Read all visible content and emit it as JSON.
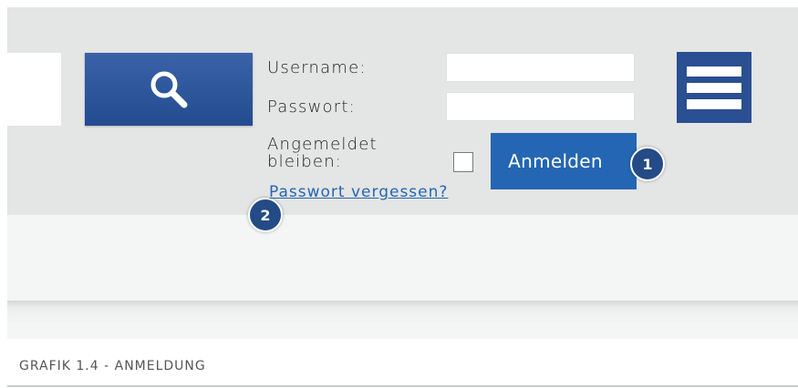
{
  "login": {
    "username_label": "Username:",
    "password_label": "Passwort:",
    "remember_label_line1": "Angemeldet",
    "remember_label_line2": "bleiben:",
    "remember_checked": false,
    "login_button": "Anmelden",
    "forgot_link": "Passwort vergessen?"
  },
  "badges": {
    "one": "1",
    "two": "2"
  },
  "caption": "GRAFIK 1.4 - ANMELDUNG",
  "icons": {
    "search": "search-icon",
    "menu": "hamburger-menu-icon"
  },
  "colors": {
    "header_background": "#e4e5e5",
    "button_blue": "#2466b3",
    "dark_blue": "#2a4f92",
    "badge_blue": "#244b86"
  }
}
